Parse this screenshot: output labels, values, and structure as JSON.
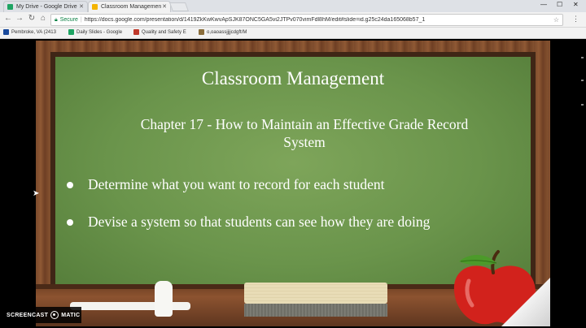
{
  "browser": {
    "tabs": [
      {
        "title": "My Drive - Google Drive",
        "favicon_color": "#1fa463"
      },
      {
        "title": "Classroom Managemen",
        "favicon_color": "#f4b400"
      }
    ],
    "address": {
      "secure_label": "Secure",
      "url": "https://docs.google.com/presentation/d/1419ZkKwKwvApSJK87ONC5GA5vi2JTPv070vimFdl8hM/edit#slide=id.g25c24da165068b57_1"
    },
    "bookmarks": [
      {
        "label": "Pembroke, VA (2413",
        "favicon_color": "#1a4a9c"
      },
      {
        "label": "Daily Slides - Google",
        "favicon_color": "#1fa463"
      },
      {
        "label": "Quality and Safety E",
        "favicon_color": "#c0392b"
      },
      {
        "label": "o,oaoassjjjjcdgft/M",
        "favicon_color": "#8a6d3b"
      }
    ]
  },
  "slide": {
    "title": "Classroom Management",
    "subtitle_line1": "Chapter 17 - How to Maintain an Effective Grade Record",
    "subtitle_line2": "System",
    "bullets": [
      "Determine what you want to record for each student",
      "Devise a system so that students can see how they are doing"
    ],
    "colors": {
      "board": "#6a944b",
      "frame": "#7b4a2c",
      "apple": "#d2221c"
    }
  },
  "watermark": {
    "left": "SCREENCAST",
    "right": "MATIC"
  }
}
